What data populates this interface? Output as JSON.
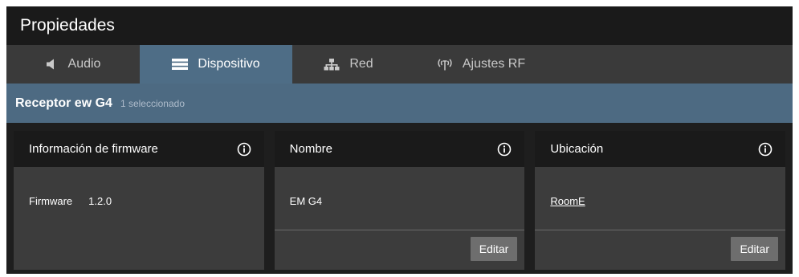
{
  "window": {
    "title": "Propiedades"
  },
  "tabs": [
    {
      "label": "Audio",
      "icon": "speaker-icon"
    },
    {
      "label": "Dispositivo",
      "icon": "device-icon",
      "active": true
    },
    {
      "label": "Red",
      "icon": "network-icon"
    },
    {
      "label": "Ajustes RF",
      "icon": "antenna-icon"
    }
  ],
  "selection": {
    "device_type": "Receptor ew G4",
    "count_text": "1 seleccionado"
  },
  "panels": {
    "firmware": {
      "title": "Información de firmware",
      "label": "Firmware",
      "value": "1.2.0"
    },
    "name": {
      "title": "Nombre",
      "value": "EM G4",
      "edit_label": "Editar"
    },
    "location": {
      "title": "Ubicación",
      "value": "RoomE",
      "edit_label": "Editar"
    }
  },
  "colors": {
    "accent": "#4e6d86",
    "header_bg": "#1a1a1a",
    "tabbar_bg": "#3a3a3a",
    "panel_bg": "#3c3c3c",
    "button_bg": "#6e6e6e"
  }
}
